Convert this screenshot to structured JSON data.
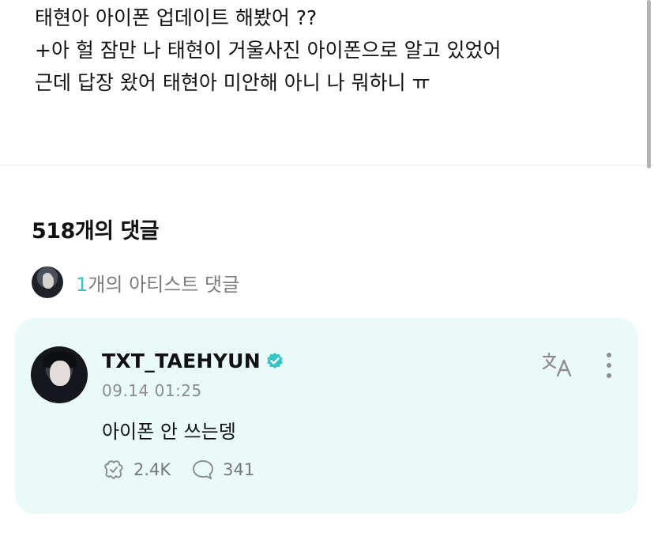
{
  "post": {
    "lines": [
      "태현아 아이폰 업데이트 해봤어 ??",
      "+아 헐 잠만 나 태현이 거울사진 아이폰으로 알고 있었어",
      "근데 답장 왔어 태현아 미안해 아니 나 뭐하니 ㅠ"
    ]
  },
  "comments": {
    "heading": "518개의 댓글",
    "artist_row": {
      "count": "1",
      "label": "개의 아티스트 댓글"
    },
    "artist_comment": {
      "username": "TXT_TAEHYUN",
      "timestamp": "09.14 01:25",
      "text": "아이폰 안 쓰는뎅",
      "likes": "2.4K",
      "replies": "341",
      "icons": [
        "verified-badge-icon",
        "translate-icon",
        "more-options-icon",
        "like-icon",
        "reply-icon"
      ]
    }
  },
  "colors": {
    "accent": "#37c3c8",
    "card_bg": "#e9faf9",
    "muted_text": "#8b8b8b"
  }
}
